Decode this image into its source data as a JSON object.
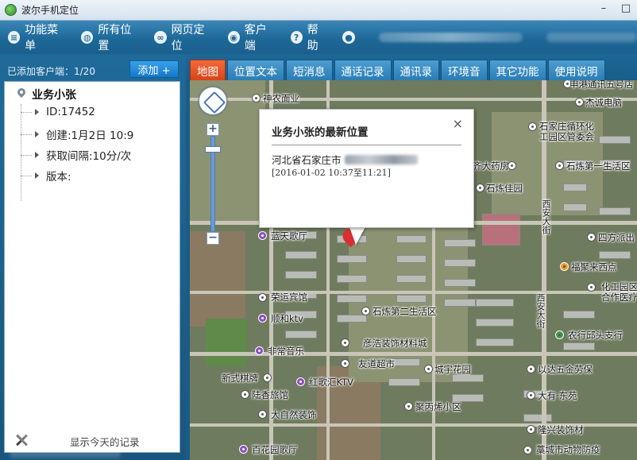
{
  "window": {
    "title": "波尔手机定位"
  },
  "menu": {
    "items": [
      {
        "label": "功能菜单",
        "icon": "menu-icon"
      },
      {
        "label": "所有位置",
        "icon": "globe-icon"
      },
      {
        "label": "网页定位",
        "icon": "link-icon"
      },
      {
        "label": "客户端",
        "icon": "camera-icon"
      },
      {
        "label": "帮助",
        "icon": "help-icon"
      }
    ],
    "user_icon": "user-icon"
  },
  "sidebar": {
    "client_count": "已添加客户端：1/20",
    "add_label": "添加 +",
    "tree": {
      "root_label": "业务小张",
      "children": [
        {
          "label": "ID:17452"
        },
        {
          "label": "创建:1月2日 10:9"
        },
        {
          "label": "获取间隔:10分/次"
        },
        {
          "label": "版本:"
        }
      ]
    },
    "today_label": "显示今天的记录"
  },
  "tabs": [
    {
      "label": "地图",
      "active": true
    },
    {
      "label": "位置文本"
    },
    {
      "label": "短消息"
    },
    {
      "label": "通话记录"
    },
    {
      "label": "通讯录"
    },
    {
      "label": "环境音"
    },
    {
      "label": "其它功能"
    },
    {
      "label": "使用说明"
    }
  ],
  "popup": {
    "title": "业务小张的最新位置",
    "address": "河北省石家庄市",
    "time": "[2016-01-02 10:37至11:21]",
    "close_label": "×"
  },
  "map_labels": {
    "l1": "神农面业",
    "l2": "申港通讯五号店",
    "l3": "杰诚电脑",
    "l4": "石家庄循环化",
    "l4b": "工园区管委会",
    "l5": "齐大药房",
    "l6": "石炼第一生活区",
    "l7": "石炼佳园",
    "l8": "西安大街",
    "l9": "四方派出",
    "l10": "蓝天歌厅",
    "l11": "福聚来西点",
    "l12": "化工园区",
    "l12b": "合作医疗",
    "l13": "荣运宾馆",
    "l14": "西安大街",
    "l15": "顺和ktv",
    "l16": "石炼第二生活区",
    "l17": "农行邱头支行",
    "l18": "非常音乐",
    "l19": "彦浩装饰材料城",
    "l20": "友道超市",
    "l21": "城宇花园",
    "l22": "以达五金劳保",
    "l23": "新式棋牌",
    "l24": "红歌汇KTV",
    "l25": "陆香旅馆",
    "l26": "大有·东苑",
    "l27": "大自然装饰",
    "l28": "聚丙烯小区",
    "l29": "隆兴装饰材",
    "l30": "百花园歌厅",
    "l31": "藁城市动物防疫"
  }
}
